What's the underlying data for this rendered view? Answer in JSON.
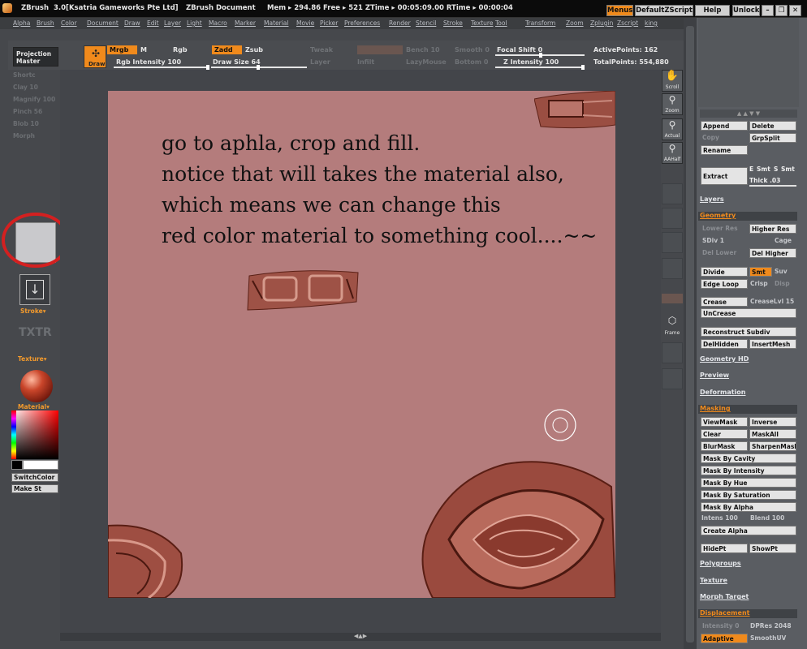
{
  "titlebar": {
    "app": "ZBrush",
    "version": "3.0[Ksatria Gameworks Pte Ltd]",
    "document": "ZBrush Document",
    "stats": "Mem ▸ 294.86  Free ▸ 521  ZTime ▸ 00:05:09.00  RTime ▸ 00:00:04",
    "menus": "Menus",
    "default_zscript": "DefaultZScript",
    "help": "Help",
    "unlock": "Unlock"
  },
  "menubar": [
    "Alpha",
    "Brush",
    "Color",
    "Document",
    "Draw",
    "Edit",
    "Layer",
    "Light",
    "Macro",
    "Marker",
    "Material",
    "Movie",
    "Picker",
    "Preferences",
    "Render",
    "Stencil",
    "Stroke",
    "Texture",
    "Tool",
    "Transform",
    "Zoom",
    "Zplugin",
    "Zscript",
    "king"
  ],
  "toolbar": {
    "projection_master": [
      "Projection",
      "Master"
    ],
    "draw": "Draw",
    "mrgb": "Mrgb",
    "m": "M",
    "rgb": "Rgb",
    "rgb_intensity": "Rgb Intensity 100",
    "zadd": "Zadd",
    "zsub": "Zsub",
    "draw_size": "Draw Size 64",
    "tweak": "Tweak",
    "layer": "Layer",
    "infilt": "Infilt",
    "lazymouse": "LazyMouse",
    "bench": "Bench 10",
    "smooth": "Smooth 0",
    "bottom": "Bottom 0",
    "focal_shift": "Focal Shift 0",
    "z_intensity": "Z Intensity 100",
    "active_points": "ActivePoints: 162",
    "total_points": "TotalPoints: 554,880"
  },
  "leftpanel": {
    "dim_items": [
      "Shortc",
      "Clay 10",
      "Magnify 100",
      "Pinch 56",
      "Blob 10",
      "Morph"
    ],
    "stroke": "Stroke▾",
    "texture_text": "TXTR",
    "texture": "Texture▾",
    "material": "Material▾",
    "switch_color": "SwitchColor",
    "make_st": "Make St",
    "alpha_accent": "#d42020"
  },
  "canvas": {
    "background": "#b47c7c",
    "annotation": [
      "go to aphla, crop and fill.",
      "notice that will takes the material also,",
      "which means we can change this",
      "red color material to something cool....~~"
    ]
  },
  "rightstrip": [
    "Scroll",
    "Zoom",
    "Actual",
    "AAHalf",
    "Frame"
  ],
  "rightpanel": {
    "append": "Append",
    "delete": "Delete",
    "copy": "Copy",
    "grpsplit": "GrpSplit",
    "rename": "Rename",
    "extract": "Extract",
    "e": "E",
    "smt": "Smt",
    "s": "S",
    "smt2": "Smt",
    "thick": "Thick .03",
    "layers": "Layers",
    "geometry": "Geometry",
    "lower_res": "Lower Res",
    "higher_res": "Higher Res",
    "sdiv": "SDiv 1",
    "cage": "Cage",
    "del_lower": "Del Lower",
    "del_higher": "Del Higher",
    "divide": "Divide",
    "smt3": "Smt",
    "suv": "Suv",
    "edge_loop": "Edge Loop",
    "crisp": "Crisp",
    "disp": "Disp",
    "crease": "Crease",
    "creaselvl": "CreaseLvl 15",
    "uncrease": "UnCrease",
    "reconstruct": "Reconstruct Subdiv",
    "delhidden": "DelHidden",
    "insertmesh": "InsertMesh",
    "geometry_hd": "Geometry HD",
    "preview": "Preview",
    "deformation": "Deformation",
    "masking": "Masking",
    "viewmask": "ViewMask",
    "inverse": "Inverse",
    "clear": "Clear",
    "maskall": "MaskAll",
    "blurmask": "BlurMask",
    "sharpenmask": "SharpenMask",
    "mask_cavity": "Mask By Cavity",
    "mask_intensity": "Mask By Intensity",
    "mask_hue": "Mask By Hue",
    "mask_saturation": "Mask By Saturation",
    "mask_alpha": "Mask By Alpha",
    "intens": "Intens 100",
    "blend": "Blend 100",
    "create_alpha": "Create Alpha",
    "hidept": "HidePt",
    "showpt": "ShowPt",
    "polygroups": "Polygroups",
    "texture": "Texture",
    "morph_target": "Morph Target",
    "displacement": "Displacement",
    "intensity": "Intensity 0",
    "dpres": "DPRes 2048",
    "adaptive": "Adaptive",
    "smoothuv": "SmoothUV"
  },
  "colors": {
    "accent": "#f08a1c",
    "panel": "#46484c",
    "canvas": "#b47c7c"
  }
}
